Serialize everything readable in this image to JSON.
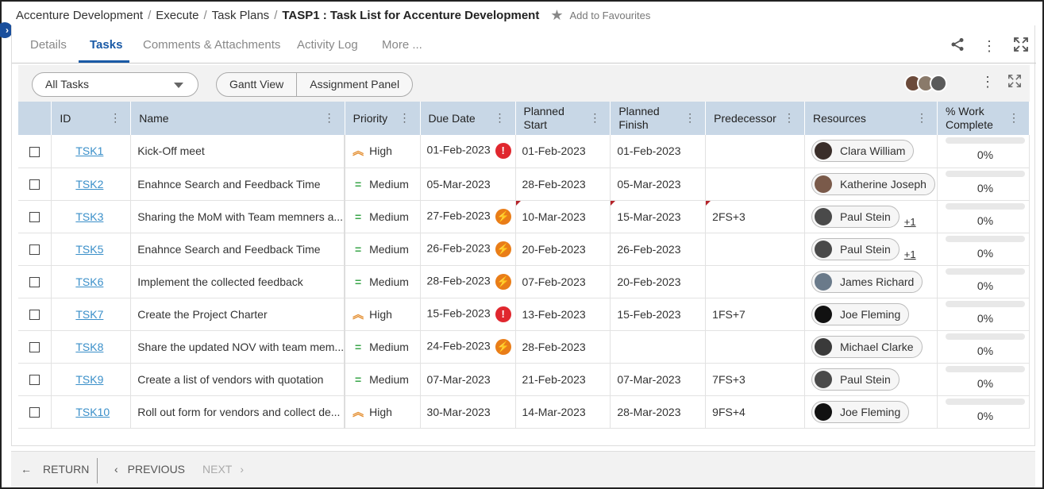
{
  "breadcrumb": {
    "items": [
      "Accenture Development",
      "Execute",
      "Task Plans"
    ],
    "current": "TASP1 : Task List for Accenture Development",
    "favourite_label": "Add to Favourites"
  },
  "tabs": [
    {
      "label": "Details"
    },
    {
      "label": "Tasks"
    },
    {
      "label": "Comments & Attachments"
    },
    {
      "label": "Activity Log"
    },
    {
      "label": "More ..."
    }
  ],
  "toolbar": {
    "filter_value": "All Tasks",
    "gantt_label": "Gantt View",
    "assignment_label": "Assignment Panel"
  },
  "columns": {
    "id": "ID",
    "name": "Name",
    "priority": "Priority",
    "due": "Due Date",
    "pstart": "Planned Start",
    "pfinish": "Planned Finish",
    "pred": "Predecessor",
    "res": "Resources",
    "work": "% Work Complete"
  },
  "colors": {
    "accent": "#1a5aa6",
    "header_bg": "#c8d7e6",
    "high": "#e48f32",
    "medium": "#3aa64a",
    "alert": "#e0272e",
    "bolt": "#e97d18"
  },
  "rows": [
    {
      "id": "TSK1",
      "name": "Kick-Off meet",
      "priority": "High",
      "due": "01-Feb-2023",
      "due_icon": "alert-icon",
      "pstart": "01-Feb-2023",
      "pfinish": "01-Feb-2023",
      "pred": "",
      "res": "Clara William",
      "res_more": "",
      "work": "0%",
      "progress": 0,
      "flags": false
    },
    {
      "id": "TSK2",
      "name": "Enahnce Search and Feedback Time",
      "priority": "Medium",
      "due": "05-Mar-2023",
      "due_icon": "",
      "pstart": "28-Feb-2023",
      "pfinish": "05-Mar-2023",
      "pred": "",
      "res": "Katherine Joseph",
      "res_more": "",
      "work": "0%",
      "progress": 0,
      "flags": false
    },
    {
      "id": "TSK3",
      "name": "Sharing the MoM with Team memners a...",
      "priority": "Medium",
      "due": "27-Feb-2023",
      "due_icon": "bolt-icon",
      "pstart": "10-Mar-2023",
      "pfinish": "15-Mar-2023",
      "pred": "2FS+3",
      "res": "Paul Stein",
      "res_more": "+1",
      "work": "0%",
      "progress": 0,
      "flags": true
    },
    {
      "id": "TSK5",
      "name": "Enahnce Search and Feedback Time",
      "priority": "Medium",
      "due": "26-Feb-2023",
      "due_icon": "bolt-icon",
      "pstart": "20-Feb-2023",
      "pfinish": "26-Feb-2023",
      "pred": "",
      "res": "Paul Stein",
      "res_more": "+1",
      "work": "0%",
      "progress": 0,
      "flags": false
    },
    {
      "id": "TSK6",
      "name": "Implement the collected feedback",
      "priority": "Medium",
      "due": "28-Feb-2023",
      "due_icon": "bolt-icon",
      "pstart": "07-Feb-2023",
      "pfinish": "20-Feb-2023",
      "pred": "",
      "res": "James Richard",
      "res_more": "",
      "work": "0%",
      "progress": 0,
      "flags": false
    },
    {
      "id": "TSK7",
      "name": "Create the Project Charter",
      "priority": "High",
      "due": "15-Feb-2023",
      "due_icon": "alert-icon",
      "pstart": "13-Feb-2023",
      "pfinish": "15-Feb-2023",
      "pred": "1FS+7",
      "res": "Joe Fleming",
      "res_more": "",
      "work": "0%",
      "progress": 0,
      "flags": false
    },
    {
      "id": "TSK8",
      "name": "Share the updated NOV with team mem...",
      "priority": "Medium",
      "due": "24-Feb-2023",
      "due_icon": "bolt-icon",
      "pstart": "28-Feb-2023",
      "pfinish": "",
      "pred": "",
      "res": "Michael Clarke",
      "res_more": "",
      "work": "0%",
      "progress": 0,
      "flags": false
    },
    {
      "id": "TSK9",
      "name": "Create a list of vendors with quotation",
      "priority": "Medium",
      "due": "07-Mar-2023",
      "due_icon": "",
      "pstart": "21-Feb-2023",
      "pfinish": "07-Mar-2023",
      "pred": "7FS+3",
      "res": "Paul Stein",
      "res_more": "",
      "work": "0%",
      "progress": 0,
      "flags": false
    },
    {
      "id": "TSK10",
      "name": "Roll out form for vendors and collect de...",
      "priority": "High",
      "due": "30-Mar-2023",
      "due_icon": "",
      "pstart": "14-Mar-2023",
      "pfinish": "28-Mar-2023",
      "pred": "9FS+4",
      "res": "Joe Fleming",
      "res_more": "",
      "work": "0%",
      "progress": 0,
      "flags": false
    }
  ],
  "footer": {
    "return_label": "RETURN",
    "previous_label": "PREVIOUS",
    "next_label": "NEXT"
  }
}
